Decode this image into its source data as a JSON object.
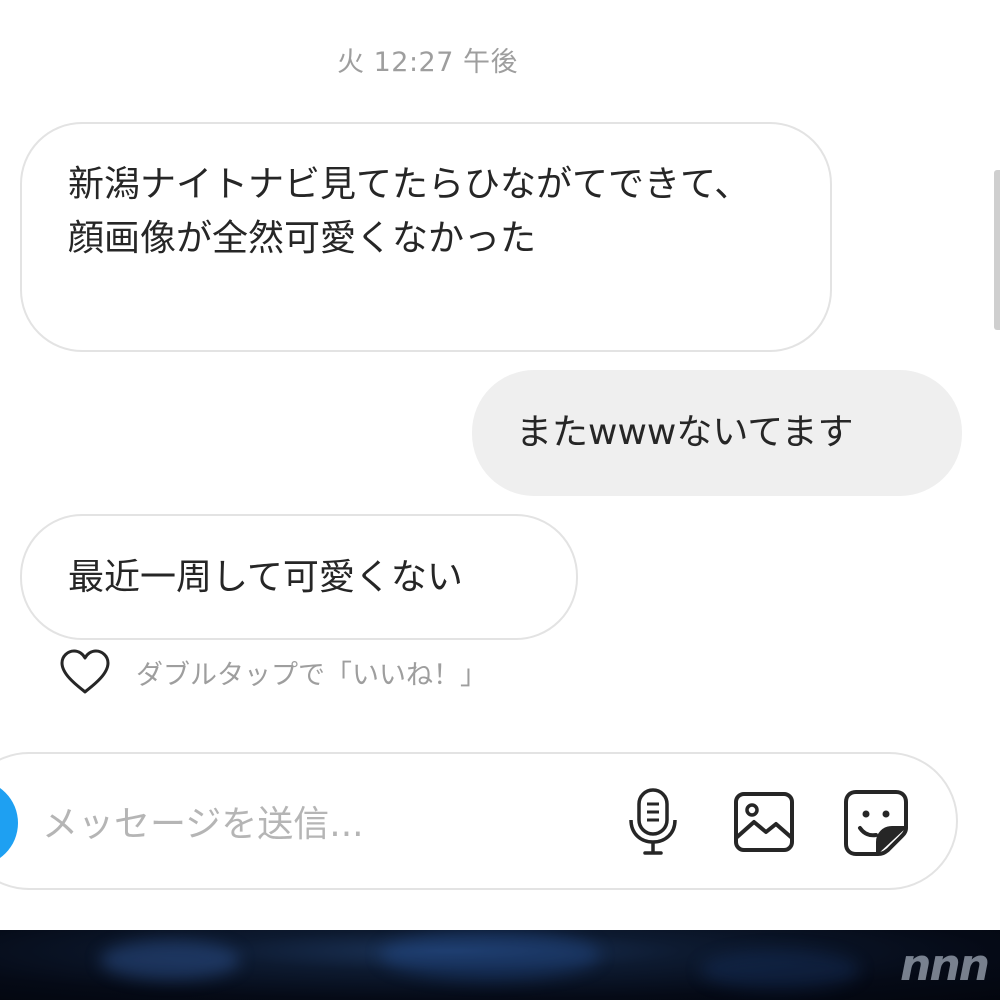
{
  "thread": {
    "timestamp": "火 12:27 午後",
    "messages": [
      {
        "direction": "incoming",
        "text": "新潟ナイトナビ見てたらひながてできて、\n顔画像が全然可愛くなかった"
      },
      {
        "direction": "outgoing",
        "text": "またwwwないてます"
      },
      {
        "direction": "incoming",
        "text": "最近一周して可愛くない"
      }
    ],
    "like_hint": "ダブルタップで「いいね！」"
  },
  "composer": {
    "placeholder": "メッセージを送信...",
    "value": ""
  },
  "icons": {
    "like": "heart-outline-icon",
    "camera": "camera-icon",
    "mic": "microphone-icon",
    "gallery": "image-gallery-icon",
    "sticker": "sticker-icon"
  },
  "colors": {
    "accent": "#1ea0f2",
    "incoming_bubble_border": "#e3e3e3",
    "outgoing_bubble_bg": "#efefef",
    "secondary_text": "#9e9e9e"
  },
  "watermark": "nnn"
}
